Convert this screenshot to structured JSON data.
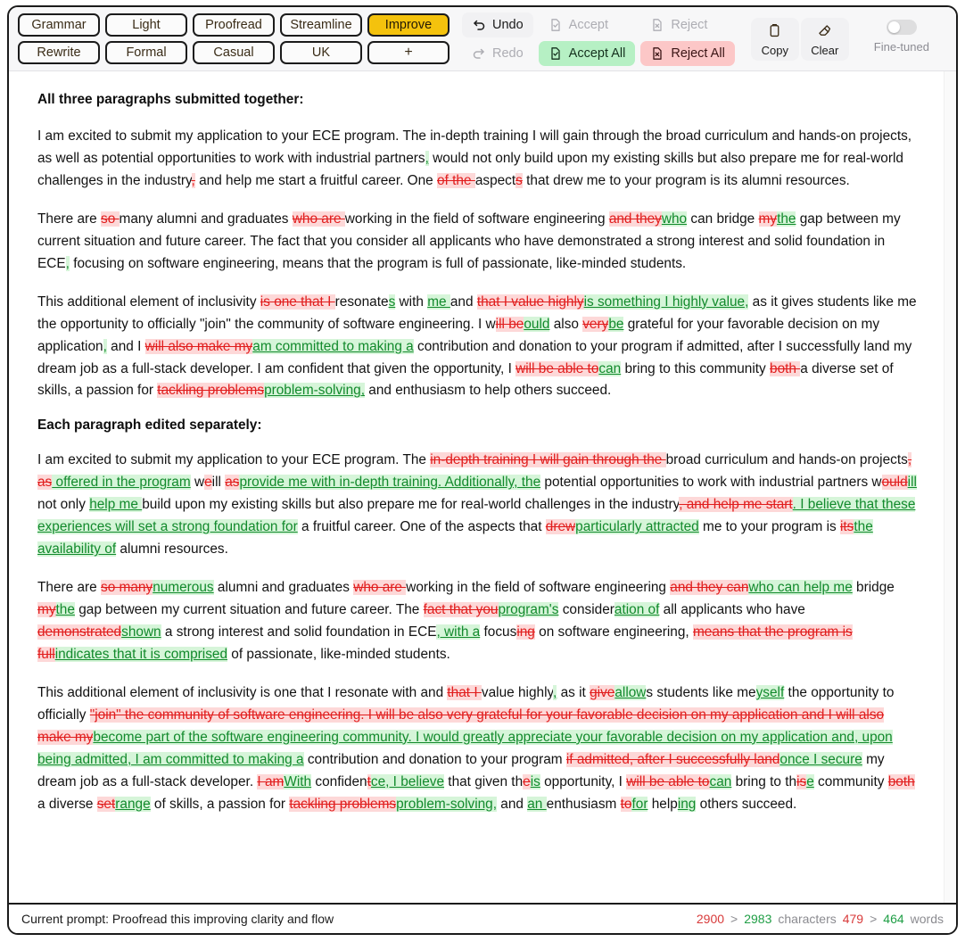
{
  "toolbar": {
    "style_chips": [
      {
        "label": "Grammar",
        "active": false
      },
      {
        "label": "Light",
        "active": false
      },
      {
        "label": "Proofread",
        "active": false
      },
      {
        "label": "Streamline",
        "active": false
      },
      {
        "label": "Improve",
        "active": true
      },
      {
        "label": "Rewrite",
        "active": false
      },
      {
        "label": "Formal",
        "active": false
      },
      {
        "label": "Casual",
        "active": false
      },
      {
        "label": "UK",
        "active": false
      },
      {
        "label": "+",
        "active": false
      }
    ],
    "undo_label": "Undo",
    "redo_label": "Redo",
    "accept_label": "Accept",
    "reject_label": "Reject",
    "accept_all_label": "Accept All",
    "reject_all_label": "Reject All",
    "copy_label": "Copy",
    "clear_label": "Clear",
    "fine_tuned_label": "Fine-tuned",
    "fine_tuned_on": false,
    "accent_active": "#f4c20d",
    "accept_all_bg": "#b6f0c4",
    "reject_all_bg": "#fcc7c7"
  },
  "document": {
    "heading_1": "All three paragraphs submitted together:",
    "heading_2": "Each paragraph edited separately:",
    "delete_color": "#e11d1d",
    "insert_color": "#128a2c"
  },
  "status": {
    "prompt_label": "Current prompt: Proofread this improving clarity and flow",
    "chars_old": "2900",
    "chars_new": "2983",
    "chars_unit": "characters",
    "words_old": "479",
    "words_new": "464",
    "words_unit": "words",
    "separator": ">"
  },
  "content": {
    "p1": [
      {
        "t": "I am excited to submit my application to your ECE program. The in-depth training I will gain through the broad curriculum and hands-on projects, as well as potential opportunities to work with industrial partners"
      },
      {
        "t": ",",
        "k": "ins"
      },
      {
        "t": " would not only build upon my existing skills but also prepare me for real-world challenges in the industry"
      },
      {
        "t": ",",
        "k": "del"
      },
      {
        "t": " and help me start a fruitful career. One "
      },
      {
        "t": "of the ",
        "k": "del"
      },
      {
        "t": "aspect"
      },
      {
        "t": "s",
        "k": "del"
      },
      {
        "t": " that drew me to your program is its alumni resources."
      }
    ],
    "p2": [
      {
        "t": "There are "
      },
      {
        "t": "so ",
        "k": "del"
      },
      {
        "t": "many alumni and graduates "
      },
      {
        "t": "who are ",
        "k": "del"
      },
      {
        "t": "working in the field of software engineering "
      },
      {
        "t": "and they",
        "k": "del"
      },
      {
        "t": "who",
        "k": "ins"
      },
      {
        "t": " can bridge "
      },
      {
        "t": "my",
        "k": "del"
      },
      {
        "t": "the",
        "k": "ins"
      },
      {
        "t": " gap between my current situation and future career. The fact that you consider all applicants who have demonstrated a strong interest and solid foundation in ECE"
      },
      {
        "t": ",",
        "k": "ins"
      },
      {
        "t": " focusing on software engineering, means that the program is full of passionate, like-minded students."
      }
    ],
    "p3": [
      {
        "t": "This additional element of inclusivity "
      },
      {
        "t": "is one that I ",
        "k": "del"
      },
      {
        "t": "resonate"
      },
      {
        "t": "s",
        "k": "ins"
      },
      {
        "t": " with "
      },
      {
        "t": "me ",
        "k": "ins"
      },
      {
        "t": "and "
      },
      {
        "t": "that I value highly",
        "k": "del"
      },
      {
        "t": "is something I highly value,",
        "k": "ins"
      },
      {
        "t": " as it gives students like me the opportunity to officially \"join\" the community of software engineering. I w"
      },
      {
        "t": "ill be",
        "k": "del"
      },
      {
        "t": "ould",
        "k": "ins"
      },
      {
        "t": " also "
      },
      {
        "t": "very",
        "k": "del"
      },
      {
        "t": "be",
        "k": "ins"
      },
      {
        "t": " grateful for your favorable decision on my application"
      },
      {
        "t": ",",
        "k": "ins"
      },
      {
        "t": " and I "
      },
      {
        "t": "will also make my",
        "k": "del"
      },
      {
        "t": "am committed to making a",
        "k": "ins"
      },
      {
        "t": " contribution and donation to your program if admitted, after I successfully land my dream job as a full-stack developer. I am confident that given the opportunity, I "
      },
      {
        "t": "will be able to",
        "k": "del"
      },
      {
        "t": "can",
        "k": "ins"
      },
      {
        "t": " bring to this community "
      },
      {
        "t": "both ",
        "k": "del"
      },
      {
        "t": "a diverse set of skills, a passion for "
      },
      {
        "t": "tackling problems",
        "k": "del"
      },
      {
        "t": "problem-solving,",
        "k": "ins"
      },
      {
        "t": " and enthusiasm to help others succeed."
      }
    ],
    "p4": [
      {
        "t": "I am excited to submit my application to your ECE program. The "
      },
      {
        "t": "in-depth training I will gain through the ",
        "k": "del"
      },
      {
        "t": "broad curriculum and hands-on projects"
      },
      {
        "t": ", as",
        "k": "del"
      },
      {
        "t": " offered in the program",
        "k": "ins"
      },
      {
        "t": " w"
      },
      {
        "t": "e",
        "k": "del"
      },
      {
        "t": "ill "
      },
      {
        "t": "as",
        "k": "del"
      },
      {
        "t": "provide me with in-depth training. Additionally, the",
        "k": "ins"
      },
      {
        "t": " potential opportunities to work with industrial partners w"
      },
      {
        "t": "ould",
        "k": "del"
      },
      {
        "t": "ill",
        "k": "ins"
      },
      {
        "t": " not only "
      },
      {
        "t": "help me ",
        "k": "ins"
      },
      {
        "t": "build upon my existing skills but also prepare me for real-world challenges in the industry"
      },
      {
        "t": ", and help me start",
        "k": "del"
      },
      {
        "t": ". I believe that these experiences will set a strong foundation for",
        "k": "ins"
      },
      {
        "t": " a fruitful career. One of the aspects that "
      },
      {
        "t": "drew",
        "k": "del"
      },
      {
        "t": "particularly attracted",
        "k": "ins"
      },
      {
        "t": " me to your program is "
      },
      {
        "t": "its",
        "k": "del"
      },
      {
        "t": "the availability of",
        "k": "ins"
      },
      {
        "t": " alumni resources."
      }
    ],
    "p5": [
      {
        "t": "There are "
      },
      {
        "t": "so many",
        "k": "del"
      },
      {
        "t": "numerous",
        "k": "ins"
      },
      {
        "t": " alumni and graduates "
      },
      {
        "t": "who are ",
        "k": "del"
      },
      {
        "t": "working in the field of software engineering "
      },
      {
        "t": "and they can",
        "k": "del"
      },
      {
        "t": "who can help me",
        "k": "ins"
      },
      {
        "t": " bridge "
      },
      {
        "t": "my",
        "k": "del"
      },
      {
        "t": "the",
        "k": "ins"
      },
      {
        "t": " gap between my current situation and future career. The "
      },
      {
        "t": "fact that you",
        "k": "del"
      },
      {
        "t": "program's",
        "k": "ins"
      },
      {
        "t": " consider"
      },
      {
        "t": "ation of",
        "k": "ins"
      },
      {
        "t": " all applicants who have "
      },
      {
        "t": "demonstrated",
        "k": "del"
      },
      {
        "t": "shown",
        "k": "ins"
      },
      {
        "t": " a strong interest and solid foundation in ECE"
      },
      {
        "t": ", with a",
        "k": "ins"
      },
      {
        "t": " focus"
      },
      {
        "t": "ing",
        "k": "del"
      },
      {
        "t": " on software engineering, "
      },
      {
        "t": "means that the program is full",
        "k": "del"
      },
      {
        "t": "indicates that it is comprised",
        "k": "ins"
      },
      {
        "t": " of passionate, like-minded students."
      }
    ],
    "p6": [
      {
        "t": "This additional element of inclusivity is one that I resonate with and "
      },
      {
        "t": "that I ",
        "k": "del"
      },
      {
        "t": "value highly"
      },
      {
        "t": ",",
        "k": "ins"
      },
      {
        "t": " as it "
      },
      {
        "t": "give",
        "k": "del"
      },
      {
        "t": "allow",
        "k": "ins"
      },
      {
        "t": "s students like me"
      },
      {
        "t": "yself",
        "k": "ins"
      },
      {
        "t": " the opportunity to officially "
      },
      {
        "t": "\"join\" the community of software engineering. I will be also very grateful for your favorable decision on my application and I will also make my",
        "k": "del"
      },
      {
        "t": "become part of the software engineering community. I would greatly appreciate your favorable decision on my application and, upon being admitted, I am committed to making a",
        "k": "ins"
      },
      {
        "t": " contribution and donation to your program "
      },
      {
        "t": "if admitted, after I successfully land",
        "k": "del"
      },
      {
        "t": "once I secure",
        "k": "ins"
      },
      {
        "t": " my dream job as a full-stack developer. "
      },
      {
        "t": "I am",
        "k": "del"
      },
      {
        "t": "With",
        "k": "ins"
      },
      {
        "t": " confiden"
      },
      {
        "t": "t",
        "k": "del"
      },
      {
        "t": "ce, I believe",
        "k": "ins"
      },
      {
        "t": " that given th"
      },
      {
        "t": "e",
        "k": "del"
      },
      {
        "t": "is",
        "k": "ins"
      },
      {
        "t": " opportunity, I "
      },
      {
        "t": "will be able to",
        "k": "del"
      },
      {
        "t": "can",
        "k": "ins"
      },
      {
        "t": " bring to th"
      },
      {
        "t": "is",
        "k": "del"
      },
      {
        "t": "e",
        "k": "ins"
      },
      {
        "t": " community "
      },
      {
        "t": "both ",
        "k": "del"
      },
      {
        "t": "a diverse "
      },
      {
        "t": "set",
        "k": "del"
      },
      {
        "t": "range",
        "k": "ins"
      },
      {
        "t": " of skills, a passion for "
      },
      {
        "t": "tackling problems",
        "k": "del"
      },
      {
        "t": "problem-solving,",
        "k": "ins"
      },
      {
        "t": " and "
      },
      {
        "t": "an ",
        "k": "ins"
      },
      {
        "t": "enthusiasm "
      },
      {
        "t": "to",
        "k": "del"
      },
      {
        "t": "for",
        "k": "ins"
      },
      {
        "t": " help"
      },
      {
        "t": "ing",
        "k": "ins"
      },
      {
        "t": " others succeed."
      }
    ]
  }
}
